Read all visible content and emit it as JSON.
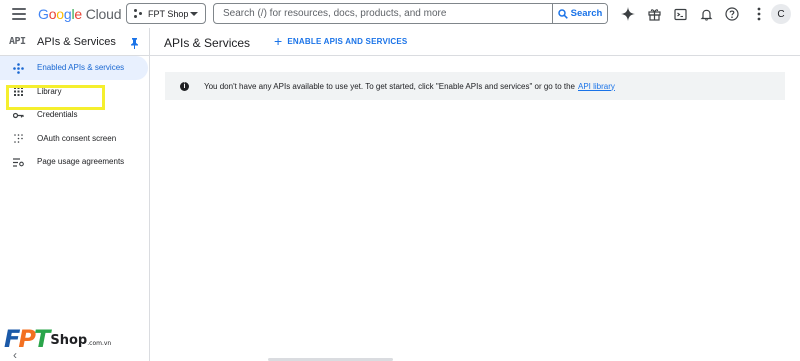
{
  "app": {
    "logo_google": [
      "G",
      "o",
      "o",
      "g",
      "l",
      "e"
    ],
    "logo_cloud": "Cloud"
  },
  "topbar": {
    "project_name": "FPT Shop",
    "search_placeholder": "Search (/) for resources, docs, products, and more",
    "search_button": "Search",
    "avatar_letter": "C"
  },
  "subheader": {
    "api_mark": "API",
    "section_title": "APIs & Services",
    "page_title": "APIs & Services",
    "enable_button": "ENABLE APIS AND SERVICES"
  },
  "sidebar": {
    "items": [
      {
        "label": "Enabled APIs & services",
        "icon": "diamond-dots-icon",
        "active": true
      },
      {
        "label": "Library",
        "icon": "library-grid-icon",
        "active": false
      },
      {
        "label": "Credentials",
        "icon": "key-icon",
        "active": false
      },
      {
        "label": "OAuth consent screen",
        "icon": "dotted-grid-icon",
        "active": false
      },
      {
        "label": "Page usage agreements",
        "icon": "settings-list-icon",
        "active": false
      }
    ]
  },
  "notice": {
    "text": "You don't have any APIs available to use yet. To get started, click \"Enable APIs and services\" or go to the",
    "link": "API library"
  },
  "watermark": {
    "fpt": [
      "F",
      "P",
      "T"
    ],
    "shop": "Shop",
    "domain": ".com.vn"
  },
  "colors": {
    "accent": "#1a73e8",
    "active_bg": "#e8f0fe",
    "highlight": "#f5ef2d",
    "notice_bg": "#f1f3f4"
  }
}
